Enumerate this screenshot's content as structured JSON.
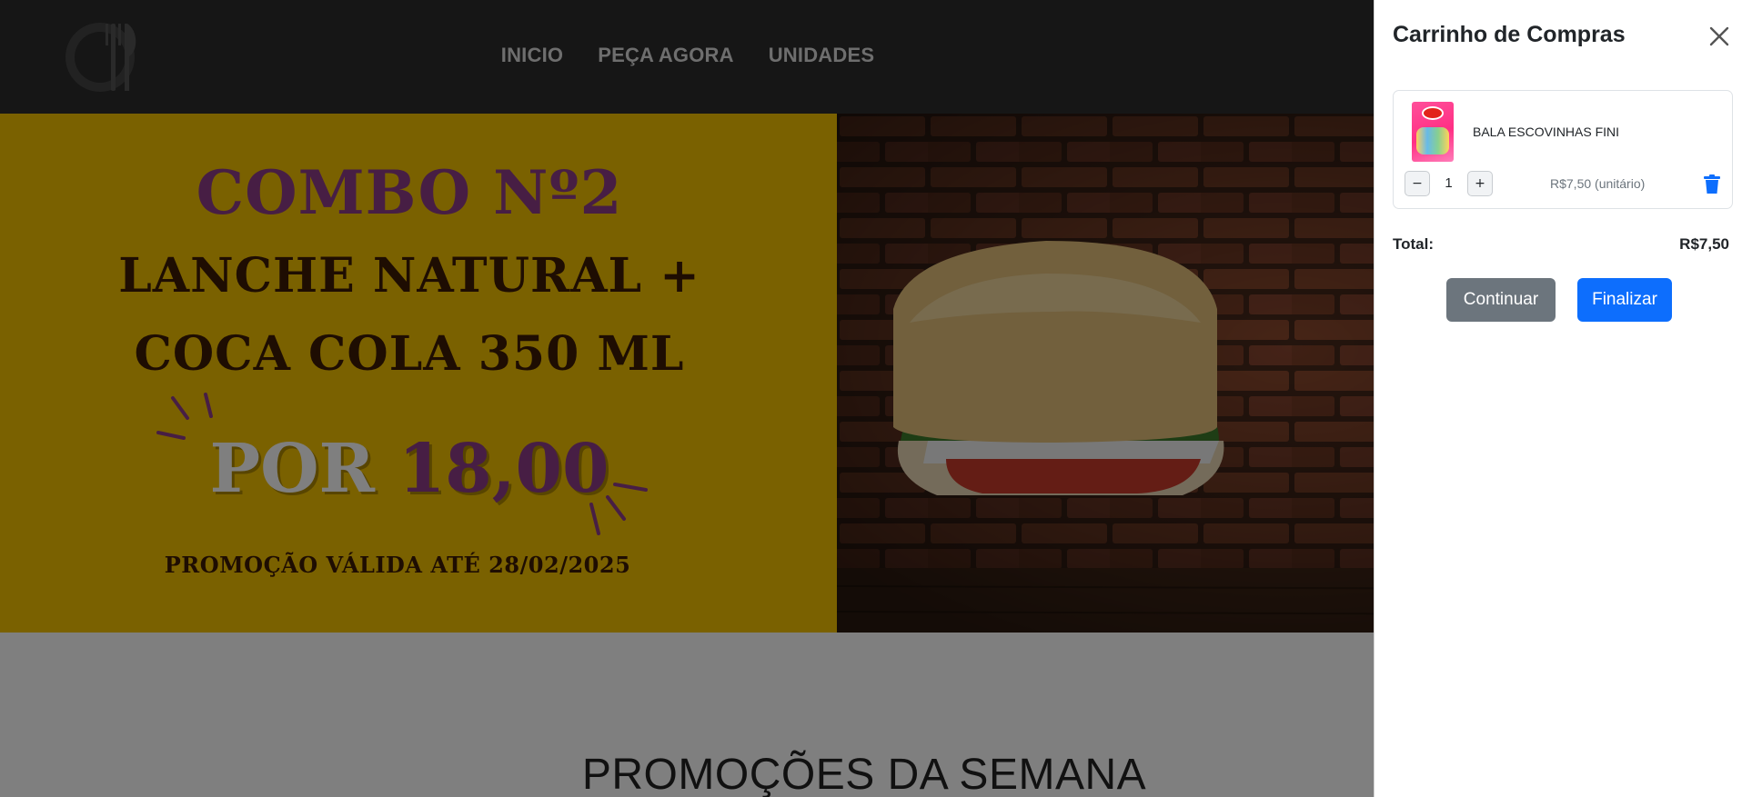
{
  "nav": {
    "links": [
      "INICIO",
      "PEÇA AGORA",
      "UNIDADES"
    ]
  },
  "banner": {
    "title": "COMBO Nº2",
    "line1": "LANCHE NATURAL +",
    "line2": "COCA COLA 350 ML",
    "price_prefix": "POR",
    "price_value": "18,00",
    "validity": "PROMOÇÃO VÁLIDA ATÉ 28/02/2025"
  },
  "section": {
    "title": "PROMOÇÕES DA SEMANA"
  },
  "cart": {
    "title": "Carrinho de Compras",
    "item": {
      "name": "BALA ESCOVINHAS FINI",
      "quantity": "1",
      "unit_price": "R$7,50 (unitário)",
      "decrement": "−",
      "increment": "+"
    },
    "total_label": "Total:",
    "total_value": "R$7,50",
    "continue_label": "Continuar",
    "finish_label": "Finalizar"
  },
  "colors": {
    "banner_yellow": "#f5c300",
    "combo_purple": "#8f3d88",
    "text_brown": "#3c1a05",
    "continue_gray": "#6c757d",
    "finish_blue": "#0d6efd",
    "trash_blue": "#0d6efd"
  },
  "icons": {
    "logo": "plate-fork-knife-icon",
    "close": "close-icon",
    "trash": "trash-icon"
  }
}
